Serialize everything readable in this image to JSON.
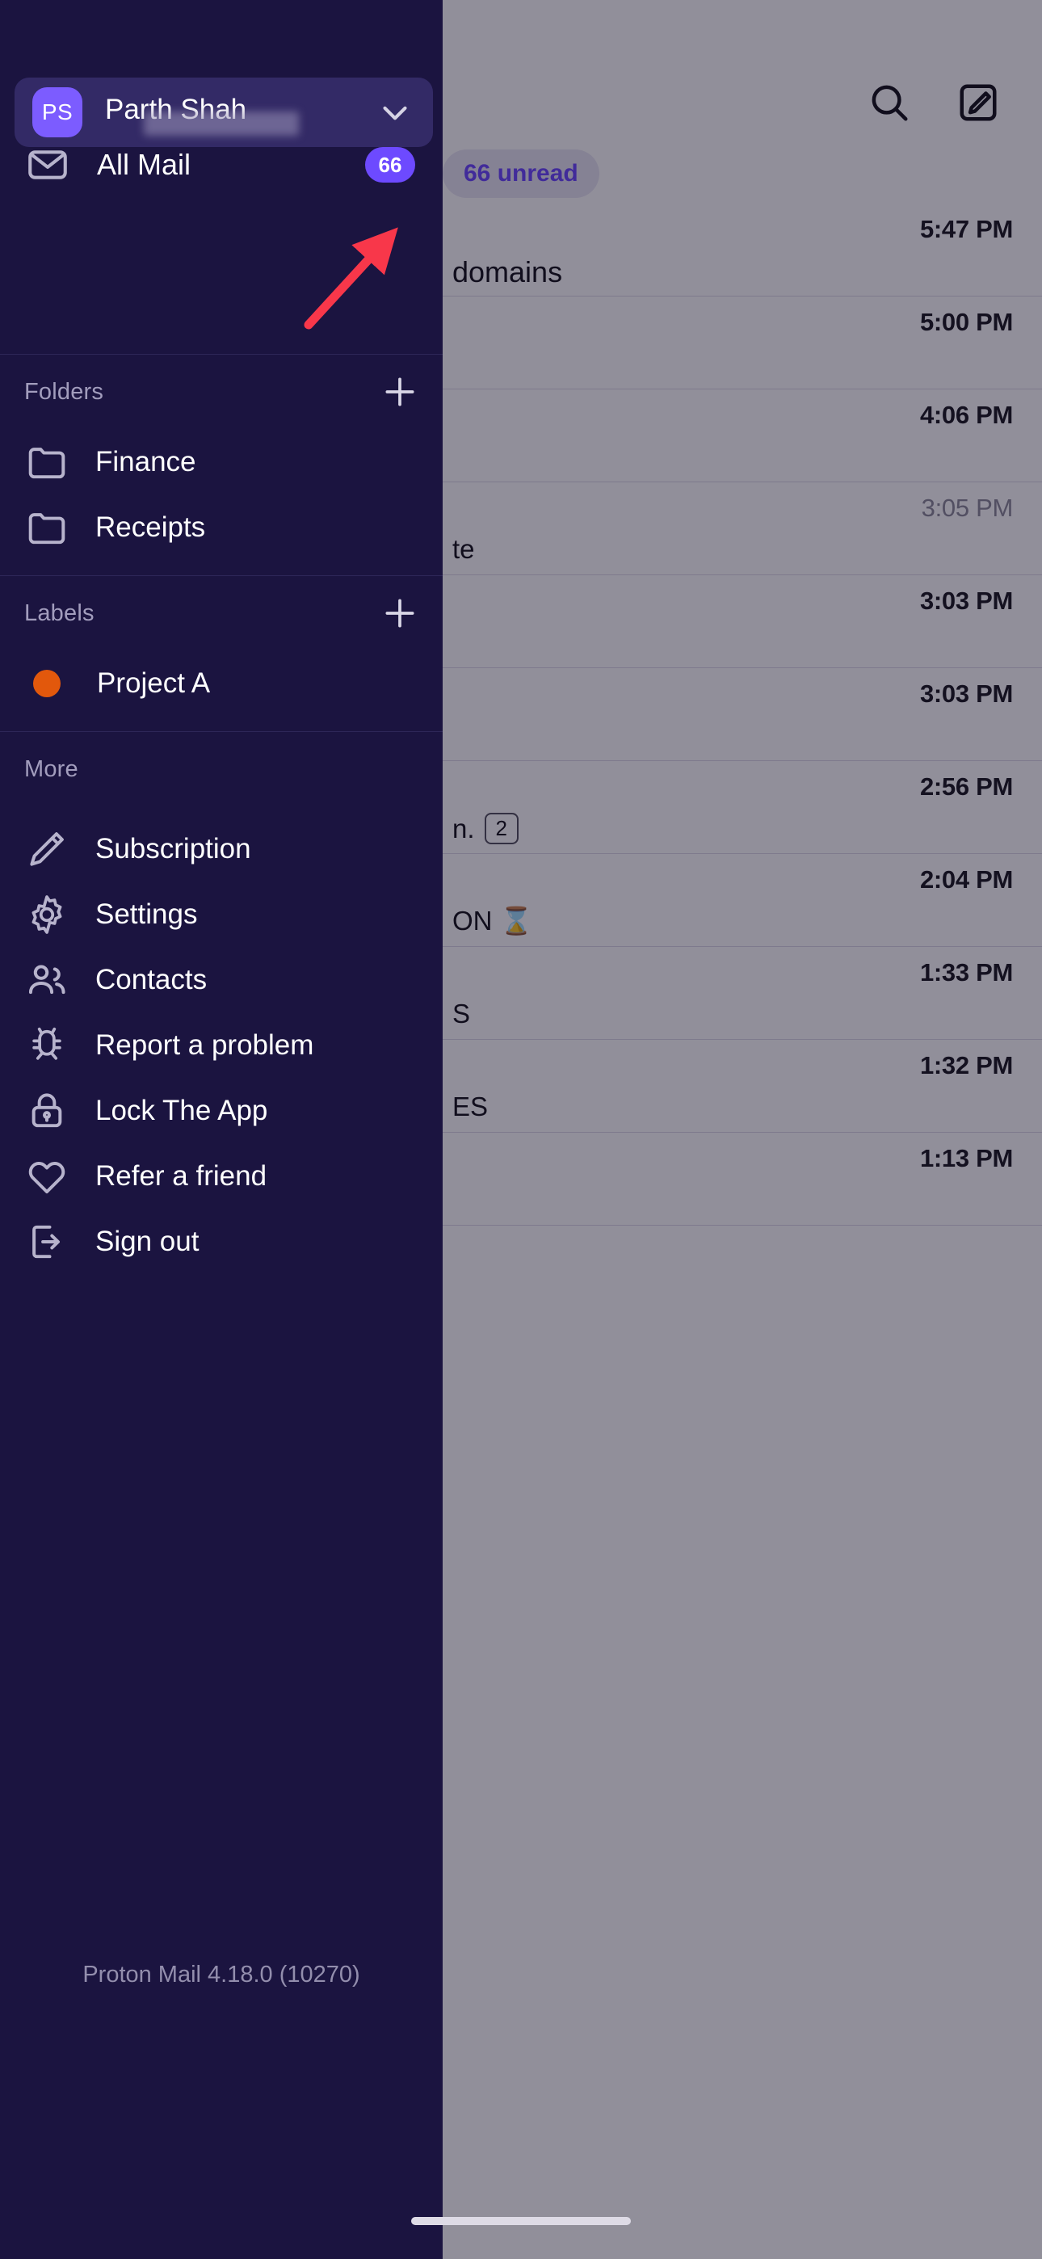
{
  "app": {
    "version_text": "Proton Mail 4.18.0 (10270)"
  },
  "account": {
    "initials": "PS",
    "name": "Parth Shah",
    "email": "",
    "chevron_icon": "chevron-down-icon",
    "avatar_color": "#7c5cff",
    "card_color": "#332a66"
  },
  "mailboxes": [
    {
      "label": "All Mail",
      "icon": "envelope-icon",
      "badge": "66"
    }
  ],
  "folders_section": {
    "title": "Folders",
    "add_icon": "plus-icon",
    "items": [
      {
        "label": "Finance",
        "icon": "folder-icon"
      },
      {
        "label": "Receipts",
        "icon": "folder-icon"
      }
    ]
  },
  "labels_section": {
    "title": "Labels",
    "add_icon": "plus-icon",
    "items": [
      {
        "label": "Project A",
        "icon": "circle-dot-icon",
        "color": "#e2580c"
      }
    ]
  },
  "more_section": {
    "title": "More",
    "items": [
      {
        "label": "Subscription",
        "icon": "pencil-icon"
      },
      {
        "label": "Settings",
        "icon": "gear-icon"
      },
      {
        "label": "Contacts",
        "icon": "people-icon"
      },
      {
        "label": "Report a problem",
        "icon": "bug-icon"
      },
      {
        "label": "Lock The App",
        "icon": "lock-icon"
      },
      {
        "label": "Refer a friend",
        "icon": "heart-icon"
      },
      {
        "label": "Sign out",
        "icon": "sign-out-icon"
      }
    ]
  },
  "background_mail": {
    "unread_pill": "66 unread",
    "accent_color": "#6d4aff",
    "toolbar_icons": [
      {
        "name": "search-icon"
      },
      {
        "name": "compose-icon"
      }
    ],
    "rows": [
      {
        "time": "5:47 PM",
        "muted": false,
        "subject": "domains",
        "count": ""
      },
      {
        "time": "5:00 PM",
        "muted": false,
        "subject": "",
        "count": ""
      },
      {
        "time": "4:06 PM",
        "muted": false,
        "subject": "",
        "count": ""
      },
      {
        "time": "3:05 PM",
        "muted": true,
        "subject": "te",
        "count": ""
      },
      {
        "time": "3:03 PM",
        "muted": false,
        "subject": "",
        "count": ""
      },
      {
        "time": "3:03 PM",
        "muted": false,
        "subject": "",
        "count": ""
      },
      {
        "time": "2:56 PM",
        "muted": false,
        "subject": "n.",
        "count": "2"
      },
      {
        "time": "2:04 PM",
        "muted": false,
        "subject": "ON ⌛",
        "count": ""
      },
      {
        "time": "1:33 PM",
        "muted": false,
        "subject": "S",
        "count": ""
      },
      {
        "time": "1:32 PM",
        "muted": false,
        "subject": "ES",
        "count": ""
      },
      {
        "time": "1:13 PM",
        "muted": false,
        "subject": "",
        "count": ""
      }
    ]
  },
  "annotation": {
    "arrow_color": "#f8374a",
    "points_to": "folders-add-button"
  }
}
